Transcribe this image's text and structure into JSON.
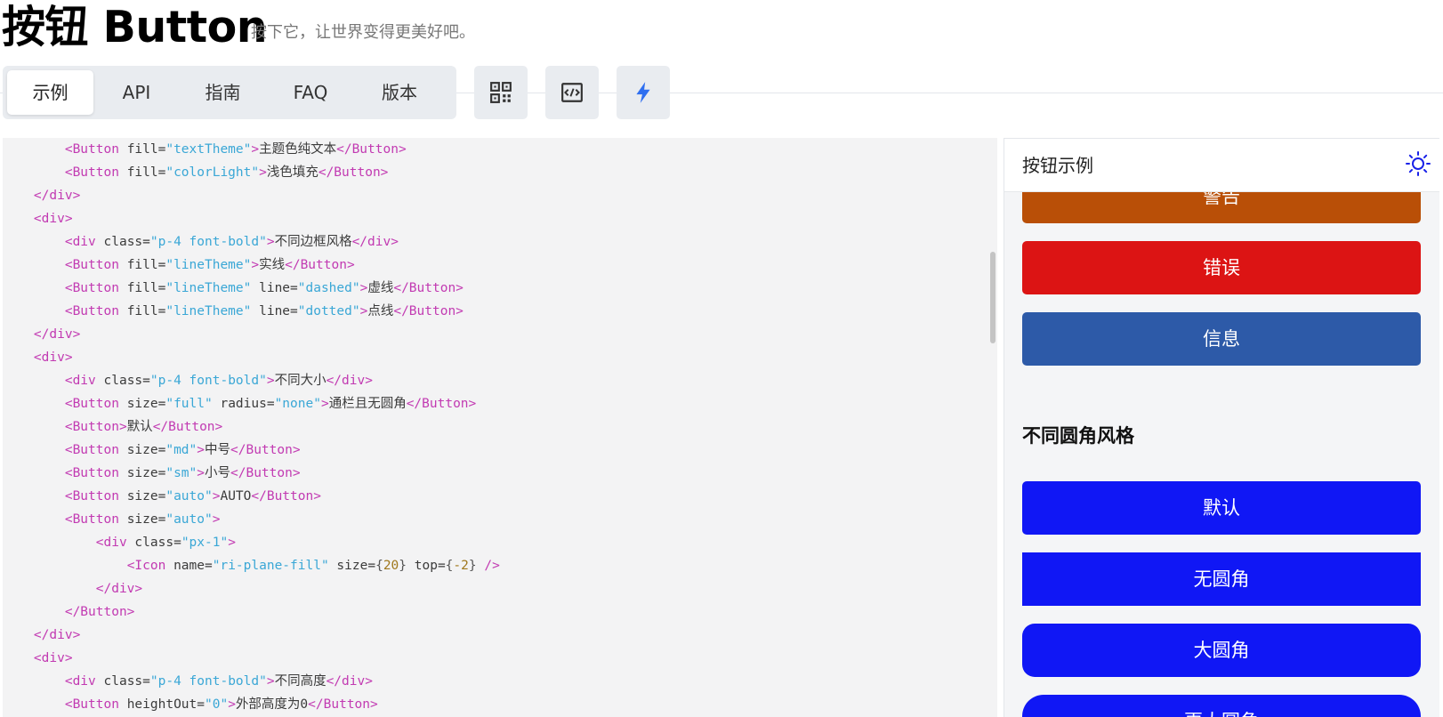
{
  "header": {
    "title": "按钮 Button",
    "subtitle": "按下它，让世界变得更美好吧。"
  },
  "tabs": [
    {
      "label": "示例",
      "active": true
    },
    {
      "label": "API",
      "active": false
    },
    {
      "label": "指南",
      "active": false
    },
    {
      "label": "FAQ",
      "active": false
    },
    {
      "label": "版本",
      "active": false
    }
  ],
  "toolbar": {
    "icons": [
      "qrcode-icon",
      "code-view-icon",
      "flash-icon"
    ]
  },
  "code": {
    "lines": [
      "        <Button fill=\"textTheme\">主题色纯文本</Button>",
      "        <Button fill=\"colorLight\">浅色填充</Button>",
      "    </div>",
      "    <div>",
      "        <div class=\"p-4 font-bold\">不同边框风格</div>",
      "        <Button fill=\"lineTheme\">实线</Button>",
      "        <Button fill=\"lineTheme\" line=\"dashed\">虚线</Button>",
      "        <Button fill=\"lineTheme\" line=\"dotted\">点线</Button>",
      "    </div>",
      "    <div>",
      "        <div class=\"p-4 font-bold\">不同大小</div>",
      "        <Button size=\"full\" radius=\"none\">通栏且无圆角</Button>",
      "        <Button>默认</Button>",
      "        <Button size=\"md\">中号</Button>",
      "        <Button size=\"sm\">小号</Button>",
      "        <Button size=\"auto\">AUTO</Button>",
      "        <Button size=\"auto\">",
      "            <div class=\"px-1\">",
      "                <Icon name=\"ri-plane-fill\" size={20} top={-2} />",
      "            </div>",
      "        </Button>",
      "    </div>",
      "    <div>",
      "        <div class=\"p-4 font-bold\">不同高度</div>",
      "        <Button heightOut=\"0\">外部高度为0</Button>"
    ]
  },
  "preview": {
    "title": "按钮示例",
    "buttons": [
      {
        "label": "警告",
        "color": "#b94f07"
      },
      {
        "label": "错误",
        "color": "#dc1414"
      },
      {
        "label": "信息",
        "color": "#2d5aa8"
      }
    ],
    "section_heading": "不同圆角风格",
    "radius_buttons": [
      {
        "label": "默认",
        "color": "#1017f5"
      },
      {
        "label": "无圆角",
        "color": "#1017f5"
      },
      {
        "label": "大圆角",
        "color": "#1017f5"
      },
      {
        "label": "更大圆角",
        "color": "#1017f5"
      }
    ]
  },
  "colors": {
    "tab_bg": "#e9ecf0",
    "code_bg": "#f3f3f4",
    "tag": "#c23ab2",
    "string": "#3aa7d6",
    "number": "#a0781d",
    "accent": "#1017f5"
  }
}
